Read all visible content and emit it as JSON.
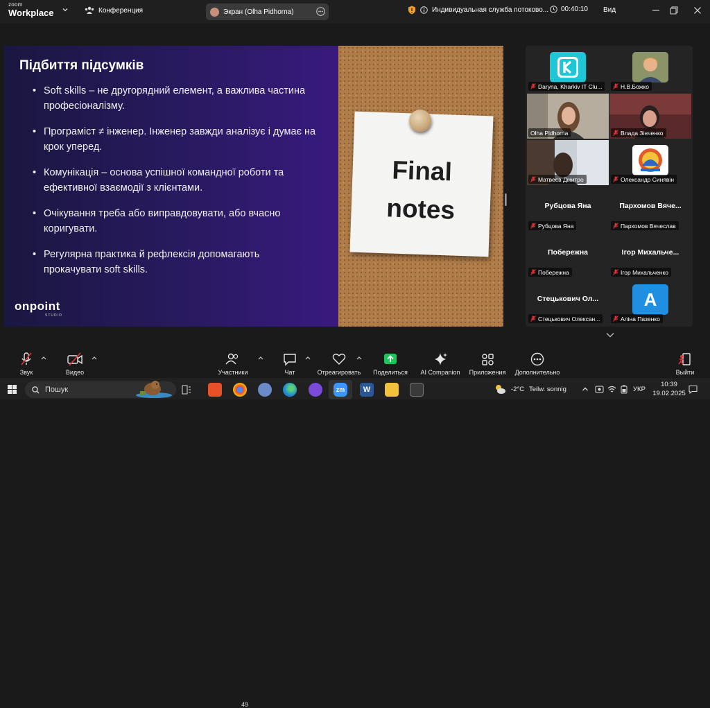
{
  "titlebar": {
    "brand_top": "zoom",
    "brand_bottom": "Workplace",
    "conference_label": "Конференция",
    "screen_pill": "Экран (Olha Pidhorna)",
    "security_label": "Индивидуальная служба потоково...",
    "timer": "00:40:10",
    "view_label": "Вид"
  },
  "slide": {
    "title": "Підбиття підсумків",
    "bullets": [
      "Soft skills – не другорядний елемент, а важлива частина професіоналізму.",
      "Програміст ≠ інженер. Інженер завжди аналізує і думає на крок уперед.",
      "Комунікація – основа успішної командної роботи та ефективної взаємодії з клієнтами.",
      "Очікування треба або виправдовувати, або вчасно коригувати.",
      "Регулярна практика й рефлексія допомагають прокачувати soft skills."
    ],
    "note_line1": "Final",
    "note_line2": "notes",
    "logo_main": "onpoint",
    "logo_sub": "STUDIO"
  },
  "participants": [
    {
      "name": "Daryna, Kharkiv IT Clu...",
      "kind": "logo",
      "logo_letter": "K",
      "color": "#1ec6d6"
    },
    {
      "name": "Н.В.Божко",
      "kind": "photo"
    },
    {
      "name": "Olha Pidhorna",
      "kind": "video",
      "active": true
    },
    {
      "name": "Влада Зінченко",
      "kind": "video"
    },
    {
      "name": "Матвеєв Дмитро",
      "kind": "video"
    },
    {
      "name": "Олександр Синявін",
      "kind": "logo-emblem"
    },
    {
      "name": "Рубцова Яна",
      "big": "Рубцова Яна",
      "kind": "name"
    },
    {
      "name": "Пархомов Вячеслав",
      "big": "Пархомов Вяче...",
      "kind": "name"
    },
    {
      "name": "Побережна",
      "big": "Побережна",
      "kind": "name"
    },
    {
      "name": "Ігор Михальченко",
      "big": "Ігор Михальче...",
      "kind": "name"
    },
    {
      "name": "Стецькович Олексан...",
      "big": "Стецькович Ол...",
      "kind": "name"
    },
    {
      "name": "Аліна Пазенко",
      "kind": "letter",
      "letter": "A",
      "color": "#1e8fe1"
    }
  ],
  "toolbar": {
    "audio": "Звук",
    "video": "Видео",
    "participants": "Участники",
    "participants_count": "49",
    "chat": "Чат",
    "react": "Отреагировать",
    "share": "Поделиться",
    "ai": "AI Companion",
    "apps": "Приложения",
    "more": "Дополнительно",
    "leave": "Выйти"
  },
  "taskbar": {
    "search_placeholder": "Пошук",
    "weather": "-2°C",
    "weather_text": "Teilw. sonnig",
    "lang": "УКР",
    "time": "10:39",
    "date": "19.02.2025"
  },
  "colors": {
    "share_green": "#1fc55a",
    "active_speaker": "#3aa55d",
    "muted_red": "#e0343a"
  }
}
